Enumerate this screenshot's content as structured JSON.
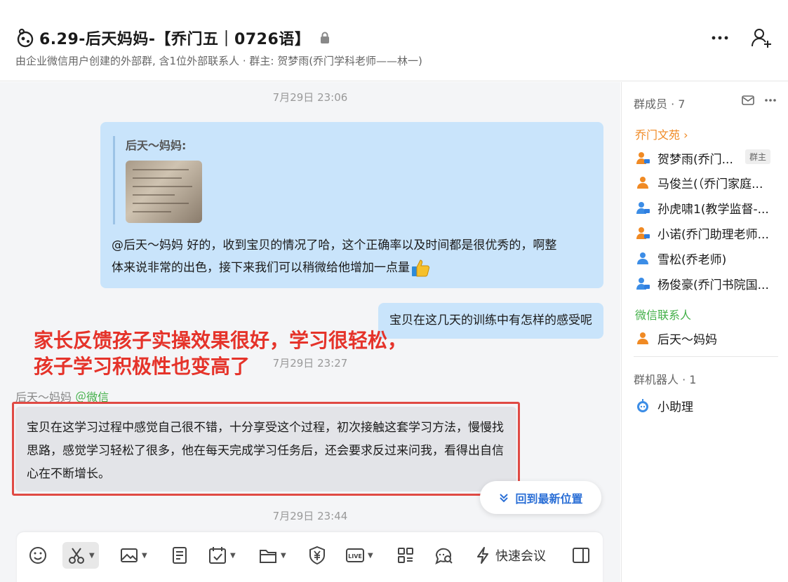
{
  "header": {
    "title": "6.29-后天妈妈-【乔门五｜0726语】",
    "subtitle": "由企业微信用户创建的外部群, 含1位外部联系人 · 群主: 贺梦雨(乔门学科老师——林一)"
  },
  "chat": {
    "time1": "7月29日 23:06",
    "quote_name": "后天～妈妈:",
    "quote_reply": "@后天～妈妈 好的，收到宝贝的情况了哈，这个正确率以及时间都是很优秀的，啊整体来说非常的出色，接下来我们可以稍微给他增加一点量",
    "right_msg": "宝贝在这几天的训练中有怎样的感受呢",
    "annotation_line1": "家长反馈孩子实操效果很好，学习很轻松，",
    "annotation_line2": "孩子学习积极性也变高了",
    "time2": "7月29日 23:27",
    "sender_name": "后天～妈妈",
    "sender_tag": "＠微信",
    "left_msg": "宝贝在这学习过程中感觉自己很不错，十分享受这个过程，初次接触这套学习方法，慢慢找思路，感觉学习轻松了很多，他在每天完成学习任务后，还会要求反过来问我，看得出自信心在不断增长。",
    "back_latest": "回到最新位置",
    "time3": "7月29日 23:44"
  },
  "toolbar": {
    "quick_meeting": "快速会议"
  },
  "sidebar": {
    "members_title": "群成员 · 7",
    "group1": "乔门文苑 ›",
    "owner_badge": "群主",
    "members": [
      "贺梦雨(乔门...",
      "马俊兰(（乔门家庭...",
      "孙虎啸1(教学监督-...",
      "小诺(乔门助理老师...",
      "雪松(乔老师)",
      "杨俊豪(乔门书院国..."
    ],
    "wechat_title": "微信联系人",
    "wechat_member": "后天～妈妈",
    "robots_title": "群机器人 · 1",
    "robot": "小助理"
  },
  "colors": {
    "accent_orange": "#f08a24",
    "accent_green": "#43b049",
    "bubble_blue": "#c9e4fb",
    "annotation_red": "#e5332a",
    "link_blue": "#2b6fd6"
  }
}
